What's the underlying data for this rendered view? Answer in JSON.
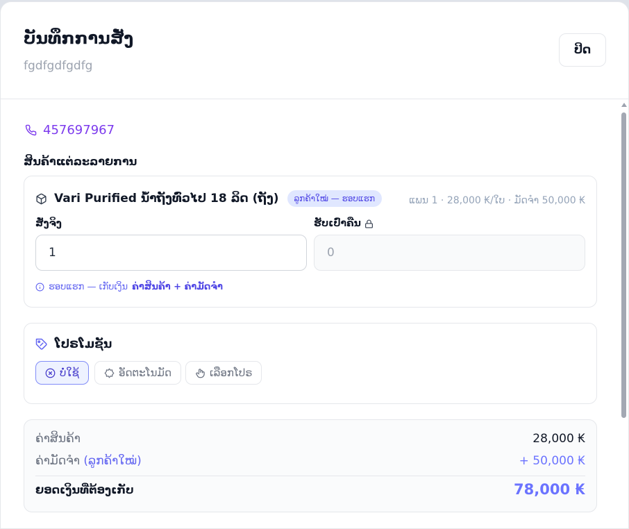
{
  "header": {
    "title": "ບັນທຶກການສັ່ງ",
    "subtitle": "fgdfgdfgdfg",
    "close_label": "ປິດ"
  },
  "customer": {
    "phone": "457697967"
  },
  "items_section": {
    "label": "ສິນຄ້າແຕ່ລະລາຍການ"
  },
  "item": {
    "name": "Vari Purified ນ້ຳຖັງທົ່ວໄປ 18 ລິດ (ຖັງ)",
    "badge": "ລູກຄ້າໃໝ່ — ຮອບແຮກ",
    "price_info": "ແພນ 1 · 28,000 ₭/ໃບ · ມັດຈຳ 50,000 ₭",
    "order_label": "ສັ່ງຈິງ",
    "order_value": "1",
    "return_label": "ຮັບເປົ່າຄືນ",
    "return_value": "0",
    "hint_prefix": "ຮອບແຮກ — ເກັບເງິນ",
    "hint_bold": "ຄ່າສິນຄ້າ + ຄ່າມັດຈຳ"
  },
  "promo": {
    "title": "ໂປຣໂມຊັນ",
    "options": [
      {
        "label": "ບໍ່ໃຊ້",
        "active": true
      },
      {
        "label": "ອັດຕະໂນມັດ",
        "active": false
      },
      {
        "label": "ເລືອກໂປຣ",
        "active": false
      }
    ]
  },
  "summary": {
    "product_label": "ຄ່າສິນຄ້າ",
    "product_value": "28,000 ₭",
    "deposit_label": "ຄ່າມັດຈຳ",
    "deposit_note": "(ລູກຄ້າໃໝ່)",
    "deposit_value": "+ 50,000 ₭",
    "total_label": "ຍອດເງິນທີ່ຕ້ອງເກັບ",
    "total_value": "78,000 ₭"
  },
  "colors": {
    "accent": "#6b73ff",
    "phone": "#7c3aed",
    "badge_bg": "#e0e7ff"
  }
}
